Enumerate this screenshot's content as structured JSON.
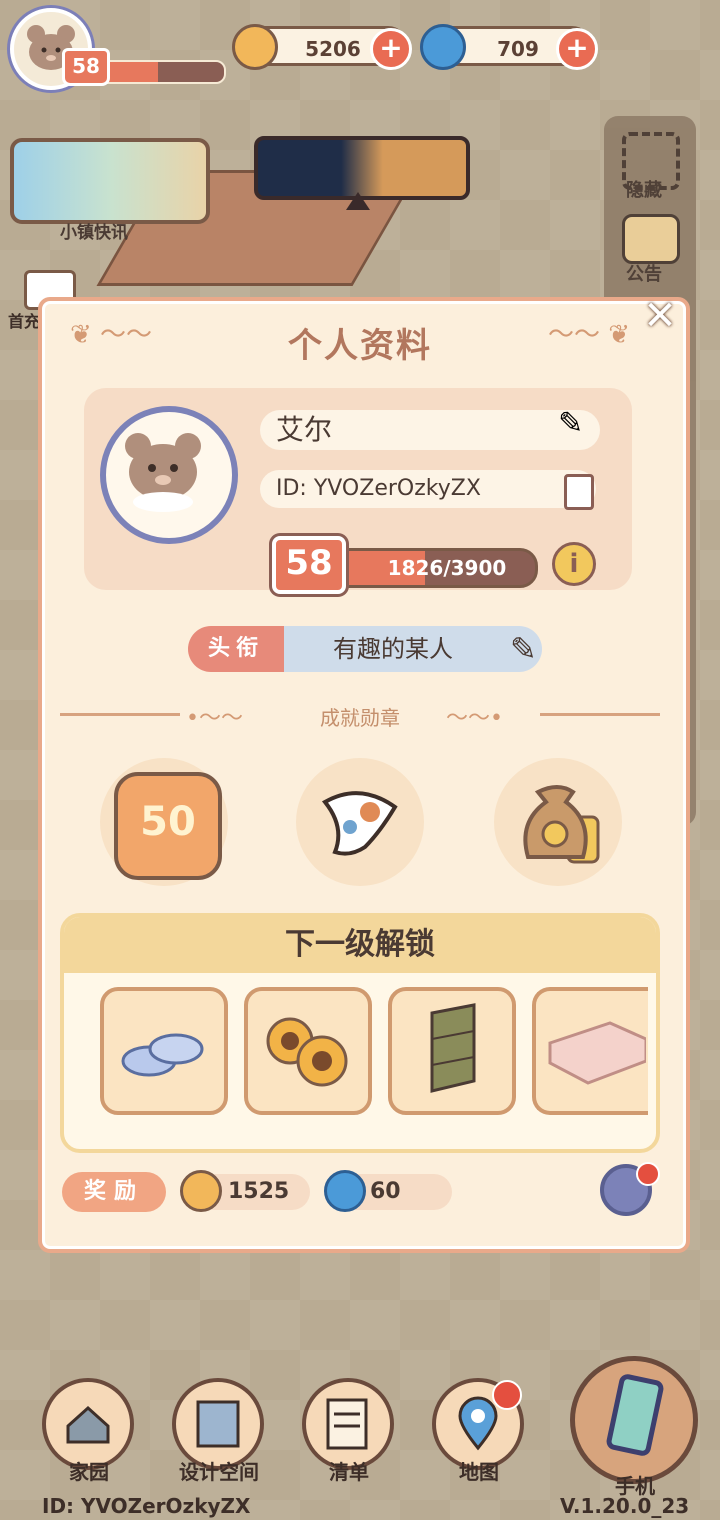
{
  "top": {
    "level": "58",
    "coins": "5206",
    "gems": "709",
    "plus": "+"
  },
  "scene": {
    "news_label": "小镇快讯",
    "side_hide": "隐藏",
    "side_notice": "公告",
    "mail_label": "首充"
  },
  "dialog": {
    "title": "个人资料",
    "close": "✕",
    "name": "艾尔",
    "id": "ID: YVOZerOzkyZX",
    "level": "58",
    "xp": "1826/3900",
    "xp_fraction": 0.468,
    "info": "i",
    "title_tag": "头衔",
    "title_value": "有趣的某人",
    "achievements_label": "成就勋章",
    "medal_level": "50",
    "unlock_header": "下一级解锁",
    "reward_tag": "奖励",
    "reward_coins": "1525",
    "reward_gems": "60"
  },
  "nav": {
    "home": "家园",
    "design": "设计空间",
    "list": "清单",
    "map": "地图",
    "phone": "手机"
  },
  "footer": {
    "id": "ID: YVOZerOzkyZX",
    "version": "V.1.20.0_23"
  },
  "colors": {
    "accent": "#e7785d",
    "dialog_bg": "#fcefdc",
    "title_text": "#b2775e"
  }
}
